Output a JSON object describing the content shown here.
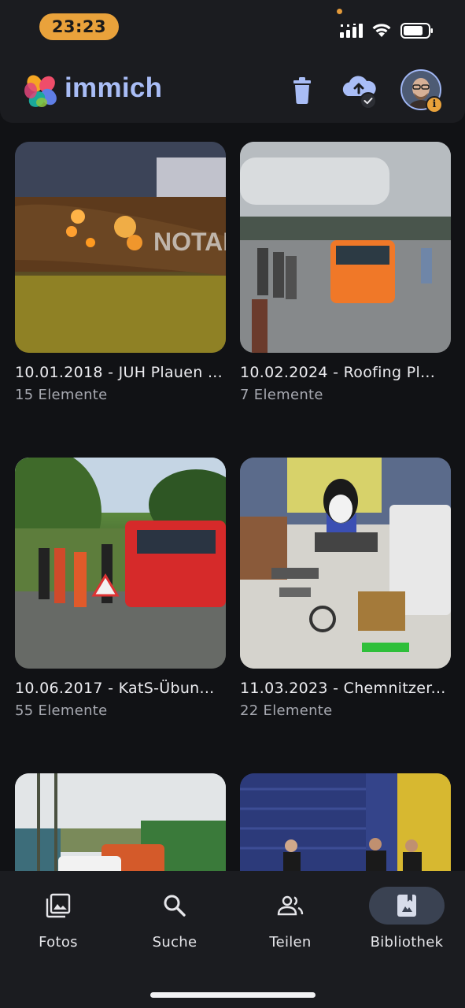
{
  "status_bar": {
    "time": "23:23"
  },
  "header": {
    "app_name": "immich",
    "avatar_badge": "i"
  },
  "albums": [
    {
      "title": "10.01.2018 - JUH Plauen ...",
      "count": "15 Elemente"
    },
    {
      "title": "10.02.2024 - Roofing Pl...",
      "count": "7 Elemente"
    },
    {
      "title": "10.06.2017 - KatS-Übun...",
      "count": "55 Elemente"
    },
    {
      "title": "11.03.2023 - Chemnitzer...",
      "count": "22 Elemente"
    },
    {
      "title": "",
      "count": ""
    },
    {
      "title": "",
      "count": ""
    }
  ],
  "thumbnail_texts": {
    "notarzt_sign": "NOTAR"
  },
  "bottom_nav": {
    "items": [
      {
        "label": "Fotos",
        "icon": "photos-icon"
      },
      {
        "label": "Suche",
        "icon": "search-icon"
      },
      {
        "label": "Teilen",
        "icon": "share-people-icon"
      },
      {
        "label": "Bibliothek",
        "icon": "library-icon",
        "active": true
      }
    ]
  },
  "colors": {
    "background": "#111215",
    "surface": "#1b1c20",
    "accent": "#a9bdf6",
    "status_pill": "#e9a23b",
    "active_pill": "#3a4252"
  }
}
